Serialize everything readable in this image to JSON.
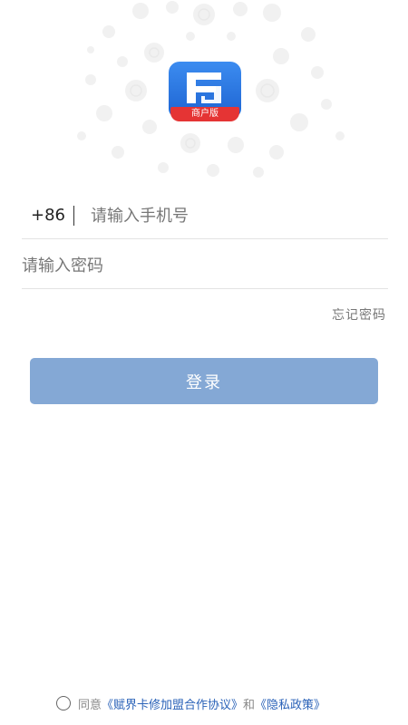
{
  "logo": {
    "badge_text": "商户版",
    "icon": "app-logo-icon"
  },
  "phone": {
    "country_code": "+86",
    "placeholder": "请输入手机号"
  },
  "password": {
    "placeholder": "请输入密码"
  },
  "forgot_label": "忘记密码",
  "login_label": "登录",
  "agreement": {
    "prefix": "同意",
    "link1": "《赋界卡修加盟合作协议》",
    "conj": "和",
    "link2": "《隐私政策》"
  },
  "colors": {
    "logo_blue": "#1e64d2",
    "logo_red": "#e53434",
    "button": "#84a8d5",
    "link": "#2a62b8"
  }
}
